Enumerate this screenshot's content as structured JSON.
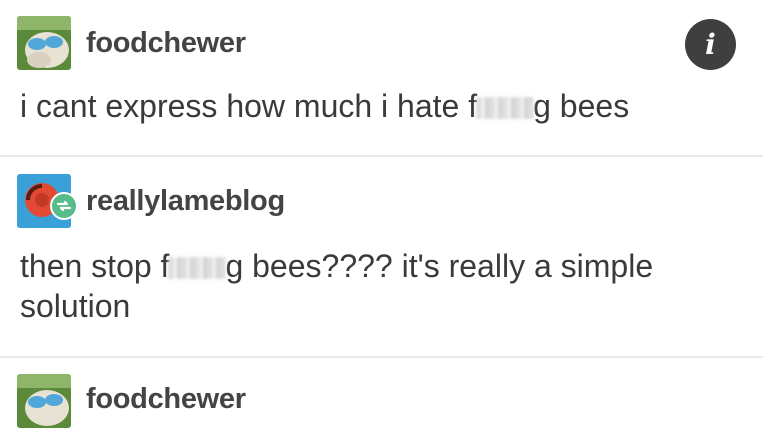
{
  "posts": [
    {
      "username": "foodchewer",
      "text_before_blur": "i cant express how much i hate f",
      "text_after_blur": "g bees"
    },
    {
      "username": "reallylameblog",
      "text_line1_before_blur": "then stop f",
      "text_line1_after_blur": "g bees???? it's really a simple",
      "text_line2": "solution"
    },
    {
      "username": "foodchewer"
    }
  ],
  "info_button": {
    "label": "i",
    "icon": "info-icon"
  },
  "colors": {
    "avatar_reblog_bg": "#3aa0d8",
    "badge": "#56bc8a",
    "info_bg": "#3f3f3f"
  }
}
